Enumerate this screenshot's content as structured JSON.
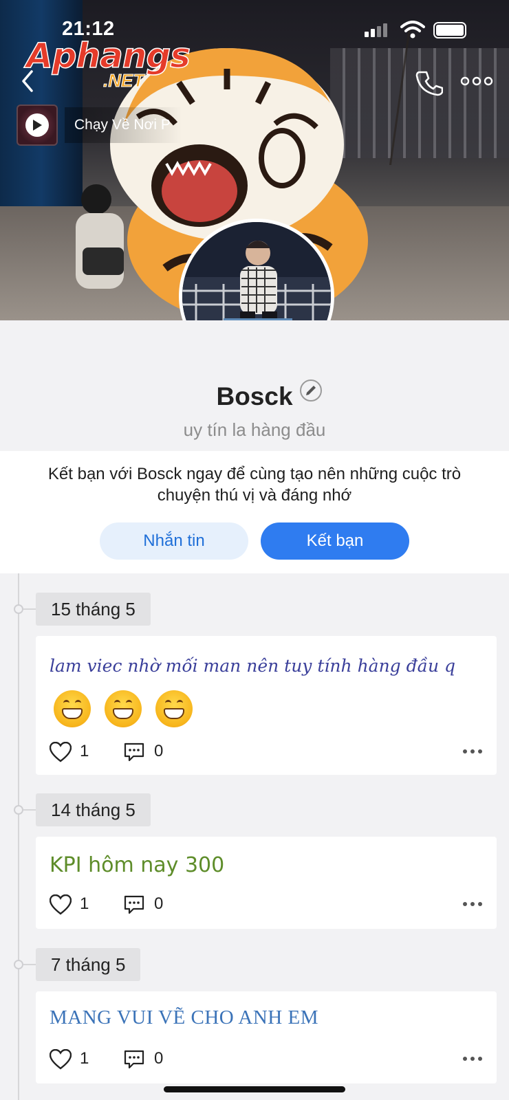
{
  "status_bar": {
    "time": "21:12"
  },
  "watermark": {
    "name": "Aphangs",
    "suffix": ".NET"
  },
  "music": {
    "title": "Chạy Về Nơi P"
  },
  "profile": {
    "name": "Bosck",
    "bio": "uy tín la hàng đầu"
  },
  "friend_prompt": {
    "text": "Kết bạn với Bosck ngay để cùng tạo nên những cuộc trò chuyện thú vị và đáng nhớ",
    "message_button": "Nhắn tin",
    "add_friend_button": "Kết bạn"
  },
  "posts": [
    {
      "date": "15 tháng 5",
      "text": "lam viec nhờ mối man nên tuy tính hàng đầu q",
      "likes": "1",
      "comments": "0"
    },
    {
      "date": "14 tháng 5",
      "text": "KPI hôm nay 300",
      "likes": "1",
      "comments": "0"
    },
    {
      "date": "7 tháng 5",
      "text": "MANG VUI VẼ CHO ANH EM",
      "likes": "1",
      "comments": "0"
    }
  ],
  "colors": {
    "primary": "#2f7cf0",
    "primary_soft": "#e6f0fc",
    "bg": "#f2f2f4"
  }
}
